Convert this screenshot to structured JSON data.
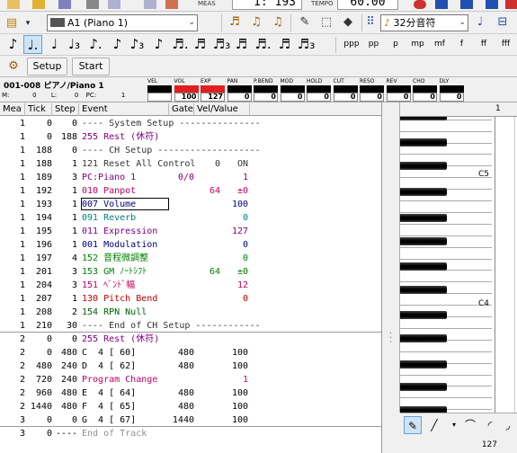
{
  "topbar": {
    "meas_label": "MEAS",
    "meas_value": "1: 193",
    "tempo_label": "TEMPO",
    "tempo_value": "60.00"
  },
  "toolbar1": {
    "instrument": "A1 (Piano 1)",
    "quantize": "32分音符"
  },
  "toolbar2": {
    "notes": [
      "♪",
      "♩.",
      "♩",
      "♩₃",
      "♪.",
      "♪",
      "♪₃",
      "♪",
      "♬.",
      "♬",
      "♬₃",
      "♬",
      "♬.",
      "♬",
      "♬₃"
    ],
    "dynamics": [
      "ppp",
      "pp",
      "p",
      "mp",
      "mf",
      "f",
      "ff",
      "fff"
    ]
  },
  "toolbar3": {
    "setup_label": "Setup",
    "start_label": "Start"
  },
  "track": {
    "name": "001-008 ピアノ/Piano 1",
    "m_label": "M:",
    "m_value": "0",
    "l_label": "L:",
    "l_value": "0",
    "pc_label": "PC:",
    "pc_value": "1",
    "meters": [
      {
        "name": "VEL",
        "value": "",
        "red": false
      },
      {
        "name": "VOL",
        "value": "100",
        "red": true
      },
      {
        "name": "EXP",
        "value": "127",
        "red": true
      },
      {
        "name": "PAN",
        "value": "0",
        "red": false
      },
      {
        "name": "P.BEND",
        "value": "0",
        "red": false
      },
      {
        "name": "MOD",
        "value": "0",
        "red": false
      },
      {
        "name": "HOLD",
        "value": "0",
        "red": false
      },
      {
        "name": "CUT",
        "value": "0",
        "red": false
      },
      {
        "name": "RESO",
        "value": "0",
        "red": false
      },
      {
        "name": "REV",
        "value": "0",
        "red": false
      },
      {
        "name": "CHO",
        "value": "0",
        "red": false
      },
      {
        "name": "DLY",
        "value": "0",
        "red": false
      }
    ]
  },
  "list": {
    "headers": [
      "Mea",
      "Tick",
      "Step",
      "Event",
      "Gate",
      "Vel/Value"
    ],
    "rows": [
      {
        "mea": "1",
        "tick": "0",
        "step": "0",
        "event": "---- System Setup ---------------",
        "gate": "",
        "v1": "",
        "v2": "",
        "color": "#333333"
      },
      {
        "mea": "1",
        "tick": "0",
        "step": "188",
        "event": "255 Rest (休符)",
        "gate": "",
        "v1": "",
        "v2": "",
        "color": "#800080"
      },
      {
        "mea": "1",
        "tick": "188",
        "step": "0",
        "event": "---- CH Setup -------------------",
        "gate": "",
        "v1": "",
        "v2": "",
        "color": "#333333"
      },
      {
        "mea": "1",
        "tick": "188",
        "step": "1",
        "event": "121 Reset All Control",
        "gate": "",
        "v1": "0",
        "v2": "ON",
        "color": "#333333"
      },
      {
        "mea": "1",
        "tick": "189",
        "step": "3",
        "event": "PC:Piano 1",
        "gate": "0/0",
        "v1": "",
        "v2": "1",
        "color": "#800080"
      },
      {
        "mea": "1",
        "tick": "192",
        "step": "1",
        "event": "010 Panpot",
        "gate": "",
        "v1": "64",
        "v2": "±0",
        "color": "#c00060"
      },
      {
        "mea": "1",
        "tick": "193",
        "step": "1",
        "event": "007 Volume",
        "gate": "",
        "v1": "",
        "v2": "100",
        "color": "#000080"
      },
      {
        "mea": "1",
        "tick": "194",
        "step": "1",
        "event": "091 Reverb",
        "gate": "",
        "v1": "",
        "v2": "0",
        "color": "#008080"
      },
      {
        "mea": "1",
        "tick": "195",
        "step": "1",
        "event": "011 Expression",
        "gate": "",
        "v1": "",
        "v2": "127",
        "color": "#800080"
      },
      {
        "mea": "1",
        "tick": "196",
        "step": "1",
        "event": "001 Modulation",
        "gate": "",
        "v1": "",
        "v2": "0",
        "color": "#000080"
      },
      {
        "mea": "1",
        "tick": "197",
        "step": "4",
        "event": "152 音程微調整",
        "gate": "",
        "v1": "",
        "v2": "0",
        "color": "#008000"
      },
      {
        "mea": "1",
        "tick": "201",
        "step": "3",
        "event": "153 GM ﾉｰﾄｼﾌﾄ",
        "gate": "",
        "v1": "64",
        "v2": "±0",
        "color": "#008000"
      },
      {
        "mea": "1",
        "tick": "204",
        "step": "3",
        "event": "151 ﾍﾞﾝﾄﾞ幅",
        "gate": "",
        "v1": "",
        "v2": "12",
        "color": "#c00060"
      },
      {
        "mea": "1",
        "tick": "207",
        "step": "1",
        "event": "130 Pitch Bend",
        "gate": "",
        "v1": "",
        "v2": "0",
        "color": "#c00000"
      },
      {
        "mea": "1",
        "tick": "208",
        "step": "2",
        "event": "154 RPN Null",
        "gate": "",
        "v1": "",
        "v2": "",
        "color": "#006000"
      },
      {
        "mea": "1",
        "tick": "210",
        "step": "30",
        "event": "---- End of CH Setup ------------",
        "gate": "",
        "v1": "",
        "v2": "",
        "color": "#333333"
      },
      {
        "mea": "2",
        "tick": "0",
        "step": "0",
        "event": "255 Rest (休符)",
        "gate": "",
        "v1": "",
        "v2": "",
        "color": "#800080"
      },
      {
        "mea": "2",
        "tick": "0",
        "step": "480",
        "event": "C  4 [ 60]",
        "gate": "480",
        "v1": "",
        "v2": "100",
        "color": "#000000"
      },
      {
        "mea": "2",
        "tick": "480",
        "step": "240",
        "event": "D  4 [ 62]",
        "gate": "480",
        "v1": "",
        "v2": "100",
        "color": "#000000"
      },
      {
        "mea": "2",
        "tick": "720",
        "step": "240",
        "event": "Program Change",
        "gate": "",
        "v1": "",
        "v2": "1",
        "color": "#c00060"
      },
      {
        "mea": "2",
        "tick": "960",
        "step": "480",
        "event": "E  4 [ 64]",
        "gate": "480",
        "v1": "",
        "v2": "100",
        "color": "#000000"
      },
      {
        "mea": "2",
        "tick": "1440",
        "step": "480",
        "event": "F  4 [ 65]",
        "gate": "480",
        "v1": "",
        "v2": "100",
        "color": "#000000"
      },
      {
        "mea": "3",
        "tick": "0",
        "step": "0",
        "event": "G  4 [ 67]",
        "gate": "1440",
        "v1": "",
        "v2": "100",
        "color": "#000000"
      },
      {
        "mea": "3",
        "tick": "0",
        "step": "----",
        "event": "End of Track",
        "gate": "",
        "v1": "",
        "v2": "",
        "color": "#909090"
      }
    ]
  },
  "piano": {
    "top_num": "1",
    "labels": [
      "C5",
      "C4"
    ]
  },
  "bottom": {
    "velocity": "127"
  }
}
